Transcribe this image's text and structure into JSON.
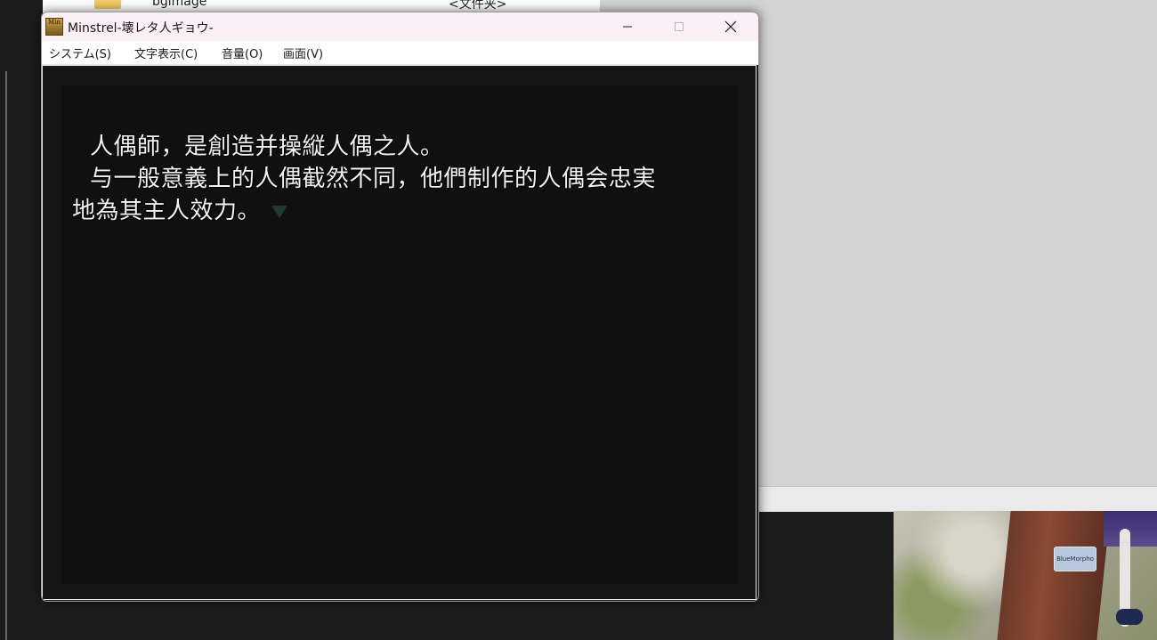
{
  "background_explorer": {
    "row_name": "bgimage",
    "row_type": "<文件夹>"
  },
  "window": {
    "title": "Minstrel-壊レタ人ギョウ-",
    "app_icon_text": "Min",
    "menu": [
      {
        "label": "システム(S)"
      },
      {
        "label": "文字表示(C)"
      },
      {
        "label": "音量(O)"
      },
      {
        "label": "画面(V)"
      }
    ],
    "controls": {
      "minimize": "minimize-icon",
      "maximize": "maximize-icon",
      "close": "close-icon"
    }
  },
  "dialogue": {
    "lines": [
      "人偶師，是創造并操縦人偶之人。",
      "与一般意義上的人偶截然不同，他們制作的人偶会忠実",
      "地為其主人效力。"
    ],
    "advance_indicator": "down-triangle-icon"
  },
  "photo": {
    "sticker_text": "BlueMorpho"
  },
  "colors": {
    "titlebar": "#fbf0f6",
    "game_background": "#101010",
    "dialogue_text": "#f2f2f2",
    "indicator": "#1f3b2c",
    "right_panel": "#d3d3d3"
  }
}
